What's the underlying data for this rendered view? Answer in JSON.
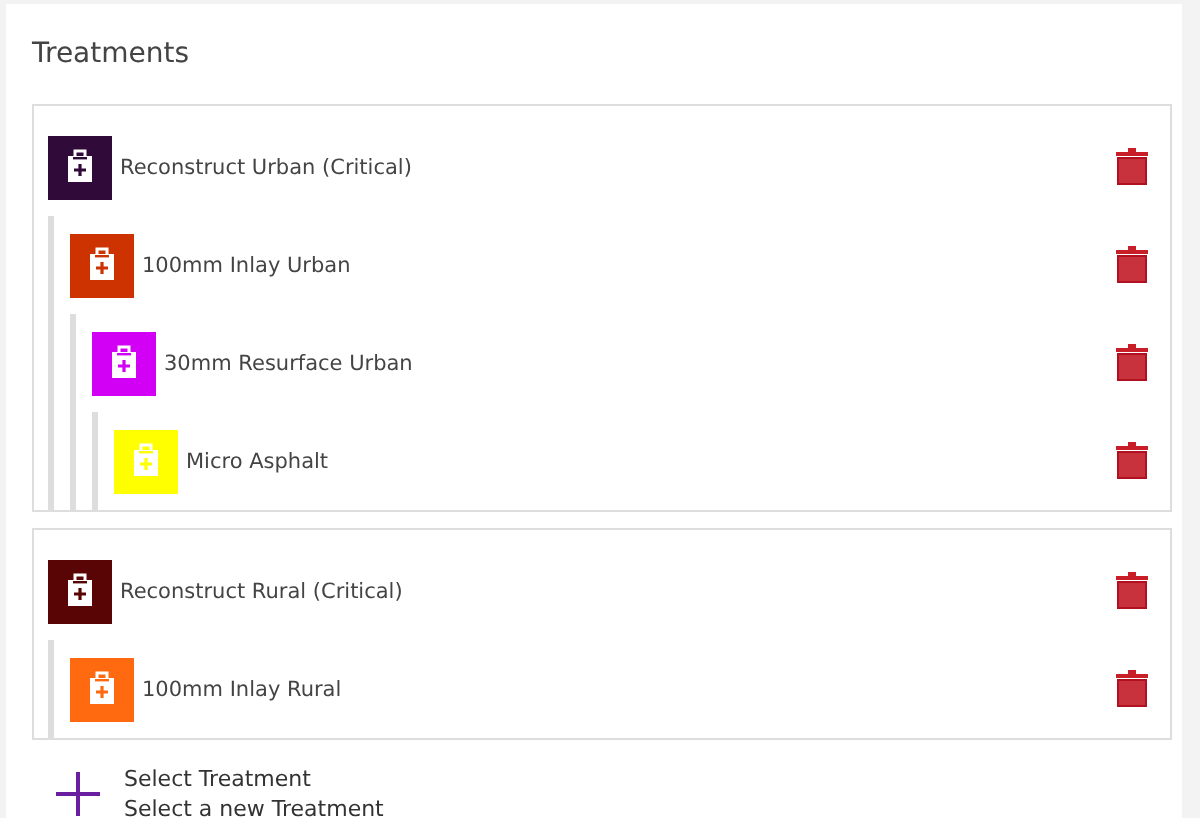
{
  "title": "Treatments",
  "groups": [
    {
      "name": "Reconstruct Urban (Critical)",
      "color": "#300a38",
      "children": [
        {
          "name": "100mm Inlay Urban",
          "color": "#cc3300",
          "children": [
            {
              "name": "30mm Resurface Urban",
              "color": "#d200f5",
              "children": [
                {
                  "name": "Micro Asphalt",
                  "color": "#ffff00"
                }
              ]
            }
          ]
        }
      ]
    },
    {
      "name": "Reconstruct Rural (Critical)",
      "color": "#5a0505",
      "children": [
        {
          "name": "100mm Inlay Rural",
          "color": "#ff6a10"
        }
      ]
    }
  ],
  "add": {
    "label": "Select Treatment",
    "hint": "Select a new Treatment"
  }
}
